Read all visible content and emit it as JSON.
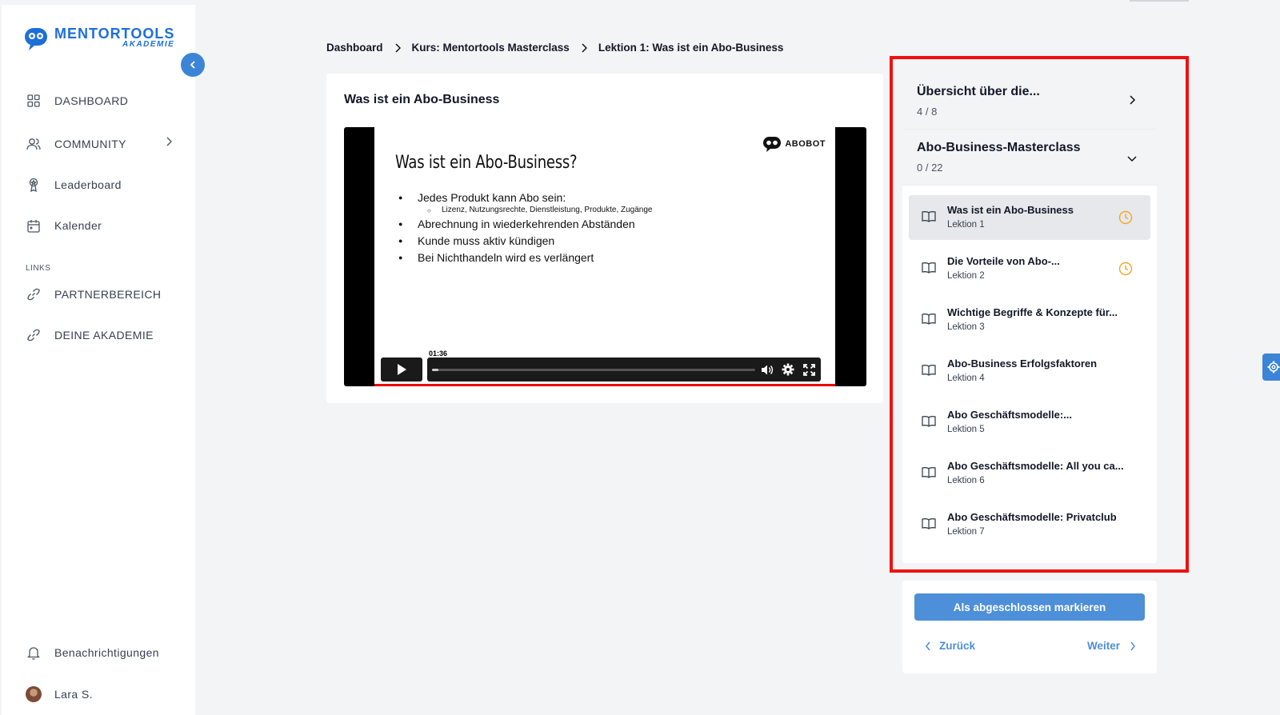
{
  "brand": {
    "name": "MENTORTOOLS",
    "sub": "AKADEMIE"
  },
  "sidebar": {
    "items": [
      {
        "label": "DASHBOARD",
        "icon": "grid-icon"
      },
      {
        "label": "COMMUNITY",
        "icon": "users-icon"
      },
      {
        "label": "Leaderboard",
        "icon": "trophy-icon"
      },
      {
        "label": "Kalender",
        "icon": "calendar-icon"
      }
    ],
    "section_label": "LINKS",
    "links": [
      {
        "label": "PARTNERBEREICH",
        "icon": "link-icon"
      },
      {
        "label": "DEINE AKADEMIE",
        "icon": "link-icon"
      }
    ],
    "notifications_label": "Benachrichtigungen",
    "user_name": "Lara S."
  },
  "breadcrumb": [
    "Dashboard",
    "Kurs: Mentortools Masterclass",
    "Lektion 1: Was ist ein Abo-Business"
  ],
  "video": {
    "card_title": "Was ist ein Abo-Business",
    "slide_title": "Was ist ein Abo-Business?",
    "slide_brand": "ABOBOT",
    "bullets": [
      "Jedes Produkt kann Abo sein:",
      "Lizenz, Nutzungsrechte, Dienstleistung, Produkte, Zugänge",
      "Abrechnung in wiederkehrenden Abständen",
      "Kunde muss aktiv kündigen",
      "Bei Nichthandeln wird es verlängert"
    ],
    "time": "01:36",
    "progress": 0.02
  },
  "panel": {
    "modules": [
      {
        "title": "Übersicht über die...",
        "count": "4 / 8"
      },
      {
        "title": "Abo-Business-Masterclass",
        "count": "0 / 22"
      }
    ],
    "lessons": [
      {
        "title": "Was ist ein Abo-Business",
        "sub": "Lektion 1",
        "clock": true
      },
      {
        "title": "Die Vorteile von Abo-...",
        "sub": "Lektion 2",
        "clock": true
      },
      {
        "title": "Wichtige Begriffe & Konzepte für...",
        "sub": "Lektion 3",
        "clock": false
      },
      {
        "title": "Abo-Business Erfolgsfaktoren",
        "sub": "Lektion 4",
        "clock": false
      },
      {
        "title": "Abo Geschäftsmodelle:...",
        "sub": "Lektion 5",
        "clock": false
      },
      {
        "title": "Abo Geschäftsmodelle: All you ca...",
        "sub": "Lektion 6",
        "clock": false
      },
      {
        "title": "Abo Geschäftsmodelle: Privatclub",
        "sub": "Lektion 7",
        "clock": false
      }
    ]
  },
  "actions": {
    "complete_label": "Als abgeschlossen markieren",
    "back_label": "Zurück",
    "next_label": "Weiter"
  },
  "colors": {
    "accent": "#3c85d6",
    "button": "#4d8fd8",
    "highlight": "#f01010",
    "clock": "#f5a623"
  }
}
